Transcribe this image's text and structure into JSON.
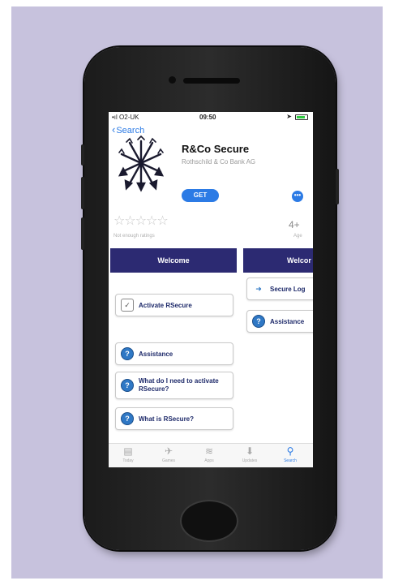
{
  "status_bar": {
    "carrier": "•ıl O2-UK",
    "time": "09:50",
    "location": "➤"
  },
  "nav": {
    "back_label": "Search"
  },
  "app": {
    "name": "R&Co Secure",
    "developer": "Rothschild & Co Bank AG",
    "get_label": "GET",
    "more_label": "•••",
    "stars": "☆☆☆☆☆",
    "rating_note": "Not enough ratings",
    "age_rating": "4+",
    "age_label": "Age"
  },
  "screenshot1": {
    "header": "Welcome",
    "activate": "Activate RSecure",
    "assistance": "Assistance",
    "what_need": "What do I need to activate RSecure?",
    "what_is": "What is RSecure?"
  },
  "screenshot2": {
    "header": "Welcor",
    "secure_login": "Secure Log",
    "assistance": "Assistance"
  },
  "tabs": [
    {
      "label": "Today",
      "icon": "today-icon"
    },
    {
      "label": "Games",
      "icon": "rocket-icon"
    },
    {
      "label": "Apps",
      "icon": "layers-icon"
    },
    {
      "label": "Updates",
      "icon": "download-icon"
    },
    {
      "label": "Search",
      "icon": "search-icon"
    }
  ],
  "colors": {
    "background": "#c7c2dd",
    "accent": "#2c7be5",
    "header_navy": "#2c2a72"
  }
}
